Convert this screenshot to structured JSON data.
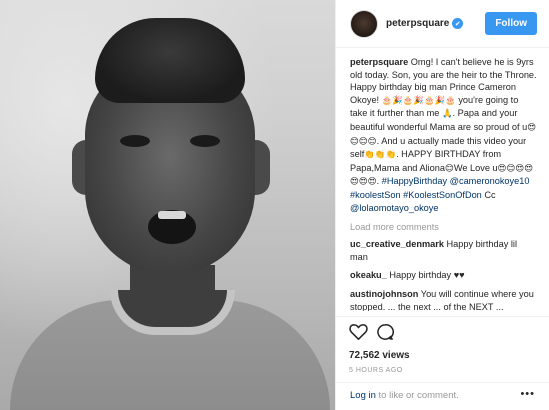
{
  "header": {
    "username": "peterpsquare",
    "verified_mark": "✔",
    "follow_label": "Follow"
  },
  "caption": {
    "username": "peterpsquare",
    "p1": "Omg! I can't believe he is 9yrs old today. Son, you are the heir to the Throne. Happy birthday big man Prince Cameron Okoye!",
    "e1": "🎂🎉🎂🎉🎂🎉🎂",
    "p2": "you're going to take it further than me",
    "e2": "🙏",
    "p3": ". Papa and your beautiful wonderful Mama are so proud of u",
    "e3": "😍😊😊😊",
    "p4": ". And u actually made this video your self",
    "e4": "👏👏👏",
    "p5": ". HAPPY BIRTHDAY from Papa,Mama and Aliona",
    "e5": "😊",
    "p6": "We Love u",
    "e6": "😍😊😍😍😍😍😍",
    "p7": ".",
    "tags": [
      "#HappyBirthday",
      "@cameronokoye10",
      "#koolestSon",
      "#KoolestSonOfDon"
    ],
    "cc": "Cc",
    "cc_tag": "@lolaomotayo_okoye"
  },
  "load_more": "Load more comments",
  "comments": [
    {
      "username": "uc_creative_denmark",
      "text": "Happy birthday lil man"
    },
    {
      "username": "okeaku_",
      "text": "Happy birthday ♥♥"
    },
    {
      "username": "austinojohnson",
      "text": "You will continue where you stopped. ... the next ... of the NEXT ..."
    }
  ],
  "actions": {
    "like_icon": "heart-icon",
    "comment_icon": "comment-icon",
    "views": "72,562 views",
    "timestamp": "5 HOURS AGO"
  },
  "footer": {
    "login": "Log in",
    "suffix": " to like or comment.",
    "more_icon": "•••"
  },
  "colors": {
    "accent": "#3897f0",
    "link": "#003569",
    "muted": "#999999"
  }
}
